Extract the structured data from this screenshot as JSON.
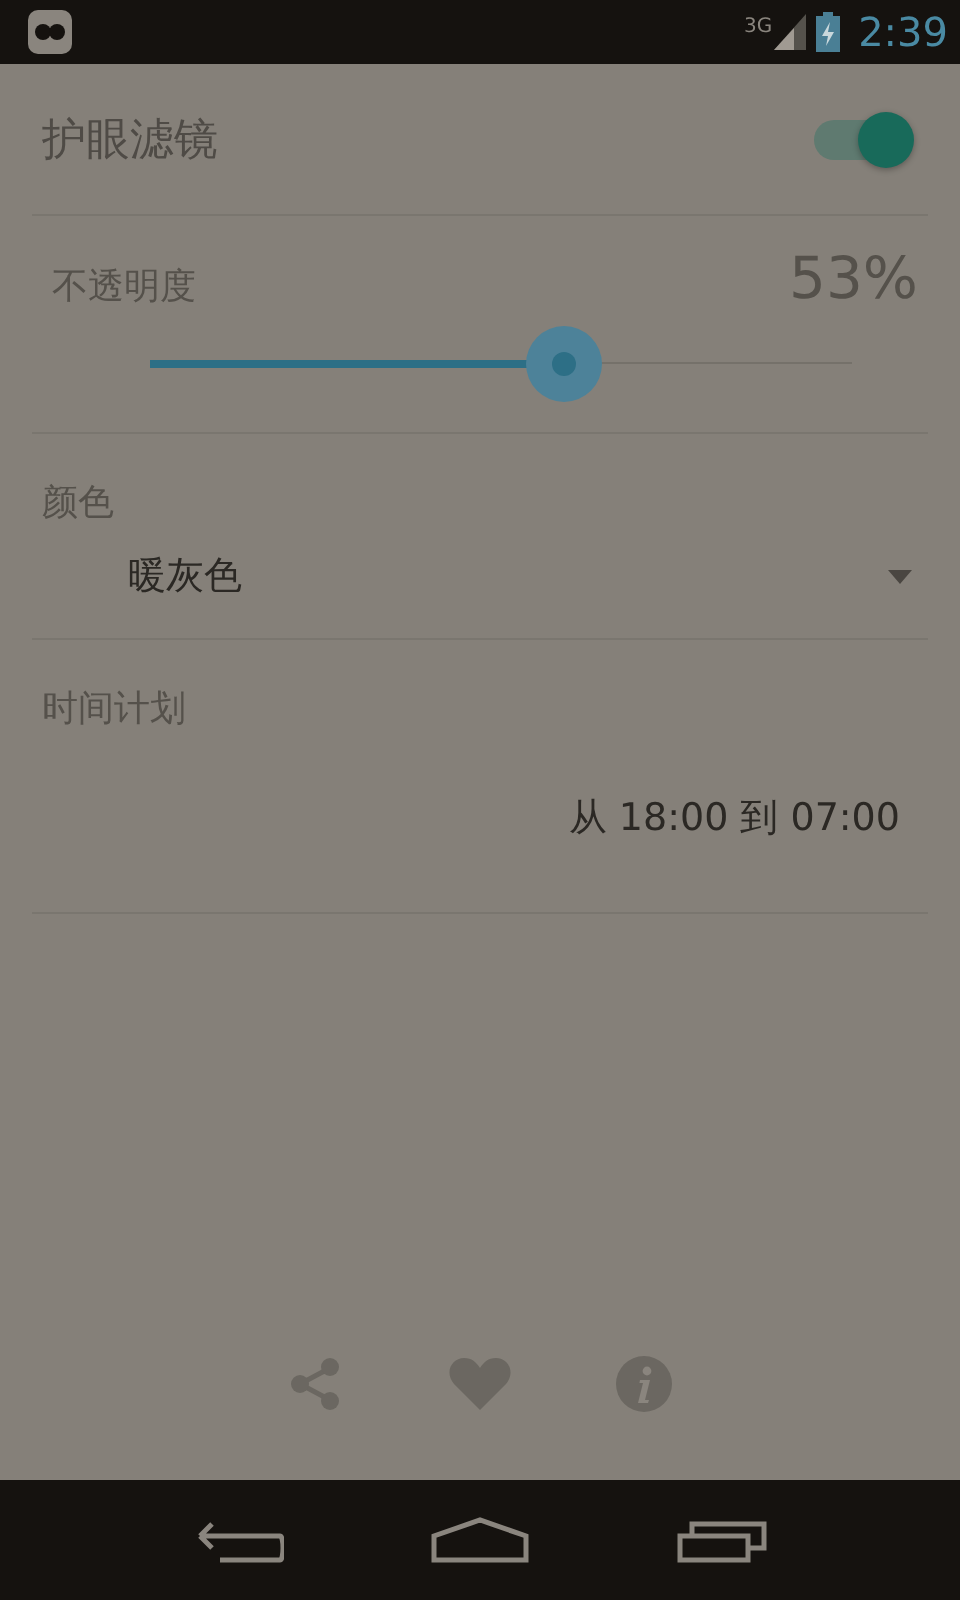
{
  "status_bar": {
    "network": "3G",
    "time": "2:39"
  },
  "filter": {
    "label": "护眼滤镜",
    "on": true
  },
  "opacity": {
    "label": "不透明度",
    "reading": "53%",
    "level": 0.59
  },
  "color": {
    "label": "颜色",
    "value": "暖灰色"
  },
  "schedule": {
    "label": "时间计划",
    "value": "从 18:00 到 07:00"
  }
}
